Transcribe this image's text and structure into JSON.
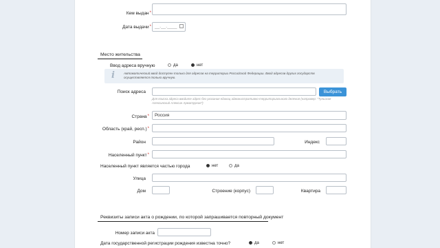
{
  "issued": {
    "issued_by_label": "Кем выдан",
    "issue_date_label": "Дата выдачи",
    "issue_date_placeholder": "__.__.____"
  },
  "residence": {
    "title": "Место жительства",
    "manual_label": "Ввод адреса вручную",
    "opt_yes": "да",
    "opt_no": "нет",
    "manual_selected": "нет",
    "info": "Автоматический ввод доступен только для адресов на территории Российской Федерации. Ввод адресов других государств осуществляется только вручную.",
    "search_label": "Поиск адреса",
    "search_button": "Выбрать",
    "search_hint": "Для поиска адреса вводите адрес без указания единиц административно-территориального деления (например: \"Тульская Алексинский Алексин Арматурная\")",
    "country_label": "Страна",
    "country_value": "Россия",
    "region_label": "Область (край, респ.)",
    "district_label": "Район",
    "index_label": "Индекс",
    "locality_label": "Населенный пункт",
    "locality_city_label": "Населенный пункт является частью города",
    "locality_city_selected": "нет",
    "street_label": "Улица",
    "house_label": "Дом",
    "building_label": "Строение (корпус)",
    "flat_label": "Квартира"
  },
  "record": {
    "title": "Реквизиты записи акта о рождении, по которой запрашивается повторный документ",
    "number_label": "Номер записи акта",
    "date_known_label": "Дата государственной регистрации рождения известна точно?",
    "opt_yes": "да",
    "opt_no": "нет",
    "date_known_selected": "да"
  },
  "colors": {
    "accent": "#3b93d8",
    "required": "#d0302a",
    "background": "#e9eef4"
  },
  "icons": {
    "info": "info-icon",
    "calendar": "calendar-icon"
  }
}
